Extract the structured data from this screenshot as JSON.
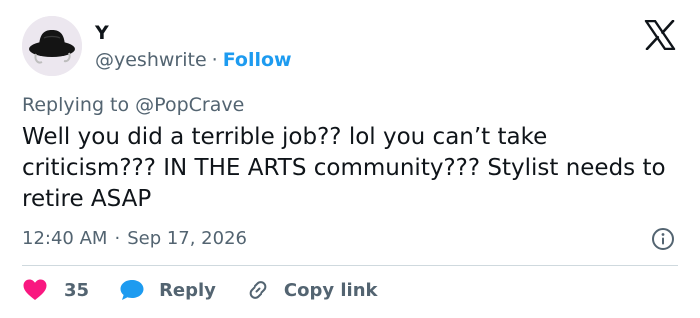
{
  "author": {
    "name": "Y",
    "handle": "@yeshwrite",
    "separator": "·",
    "follow_label": "Follow",
    "avatar_icon": "bucket-hat-avatar"
  },
  "brand_icon": "x-logo-icon",
  "reply_context": {
    "prefix": "Replying to",
    "mention": "@PopCrave"
  },
  "tweet": {
    "text": "Well you did a terrible job?? lol you can’t take criticism??? IN THE ARTS community??? Stylist needs to retire ASAP",
    "time": "12:40 AM",
    "separator": "·",
    "date": "Sep 17, 2026"
  },
  "actions": {
    "like_count": "35",
    "reply_label": "Reply",
    "copy_label": "Copy link"
  },
  "colors": {
    "accent": "#1d9bf0",
    "like": "#f91880",
    "muted": "#536471",
    "text": "#0f1419",
    "divider": "#cfd9de"
  }
}
